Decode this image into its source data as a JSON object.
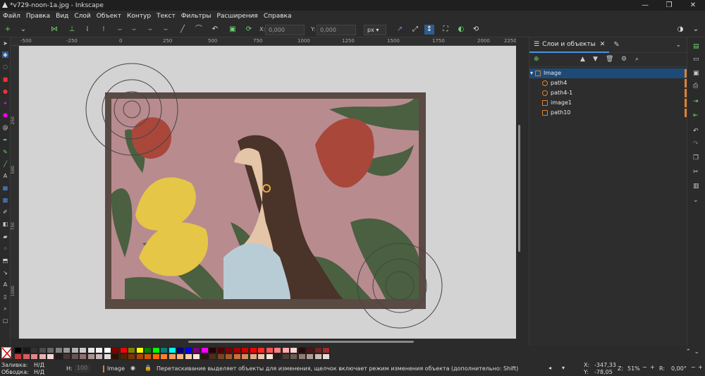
{
  "window": {
    "title": "*v729-noon-1a.jpg - Inkscape",
    "controls": [
      "—",
      "❐",
      "✕"
    ]
  },
  "menu": [
    "Файл",
    "Правка",
    "Вид",
    "Слой",
    "Объект",
    "Контур",
    "Текст",
    "Фильтры",
    "Расширения",
    "Справка"
  ],
  "tool_controls": {
    "x_label": "X:",
    "x_value": "0,000",
    "y_label": "Y:",
    "y_value": "0,000",
    "unit": "px"
  },
  "ruler": {
    "h_ticks": [
      "-500",
      "-250",
      "0",
      "250",
      "500",
      "750",
      "1000",
      "1250",
      "1500",
      "1750",
      "2000",
      "2250"
    ],
    "v_ticks": [
      "250",
      "500",
      "750",
      "1000"
    ]
  },
  "panel": {
    "tab_label": "Слои и объекты",
    "layers": [
      {
        "name": "Image",
        "level": 0,
        "icon": "layer-icon",
        "selected": true
      },
      {
        "name": "path4",
        "level": 1,
        "icon": "path-icon",
        "selected": false
      },
      {
        "name": "path4-1",
        "level": 1,
        "icon": "path-icon",
        "selected": false
      },
      {
        "name": "image1",
        "level": 1,
        "icon": "image-icon",
        "selected": false
      },
      {
        "name": "path10",
        "level": 1,
        "icon": "bezier-icon",
        "selected": false
      }
    ]
  },
  "palette": {
    "colors": [
      "#000000",
      "#1a1a1a",
      "#333333",
      "#4d4d4d",
      "#666666",
      "#808080",
      "#999999",
      "#b3b3b3",
      "#cccccc",
      "#e6e6e6",
      "#f2f2f2",
      "#ffffff",
      "#800000",
      "#ff0000",
      "#808000",
      "#ffff00",
      "#008000",
      "#00ff00",
      "#008080",
      "#00ffff",
      "#000080",
      "#0000ff",
      "#800080",
      "#ff00ff",
      "#2b0000",
      "#550000",
      "#800000",
      "#aa0000",
      "#d40000",
      "#ff0000",
      "#ff2a2a",
      "#ff5555",
      "#ff8080",
      "#ffaaaa",
      "#ffd5d5",
      "#280b0b",
      "#501616",
      "#782121",
      "#a02c2c",
      "#c83737",
      "#d35f5f",
      "#de8787",
      "#e9afaf",
      "#f4d7d7",
      "#241c1c",
      "#483737",
      "#6c5353",
      "#916f6f",
      "#ac9393",
      "#c8b7b7",
      "#e3dbdb",
      "#2b1100",
      "#552200",
      "#803300",
      "#aa4400",
      "#d45500",
      "#ff6600",
      "#ff7f2a",
      "#ff9955",
      "#ffb380",
      "#ffccaa",
      "#ffe6d5",
      "#28170b",
      "#502d16",
      "#784421",
      "#a05a2c",
      "#c87137",
      "#d38d5f",
      "#deaa87",
      "#e9c6af",
      "#f4e3d7",
      "#241f1c",
      "#483e37",
      "#6c5d53",
      "#917c6f",
      "#ac9d93",
      "#c8beb7",
      "#e3dedb"
    ]
  },
  "status": {
    "fill_label": "Заливка:",
    "fill_value": "Н/Д",
    "stroke_label": "Обводка:",
    "stroke_value": "Н/Д",
    "h_label": "H:",
    "h_value": "100",
    "layer": "Image",
    "message": "Перетаскивание выделяет объекты для изменения, щелчок включает режим изменения объекта (дополнительно: Shift)",
    "cursor_x_label": "X:",
    "cursor_x": "-347,33",
    "cursor_y_label": "Y:",
    "cursor_y": "-78,05",
    "zoom_label": "Z:",
    "zoom": "51%",
    "rotation_label": "R:",
    "rotation": "0,00°"
  },
  "colors": {
    "accent": "#4a90e2",
    "selection": "#1e4a78",
    "layer_marker": "#e0822e",
    "artwork_frame": "#5a4a44",
    "artwork_bg": "#b88b8f"
  }
}
